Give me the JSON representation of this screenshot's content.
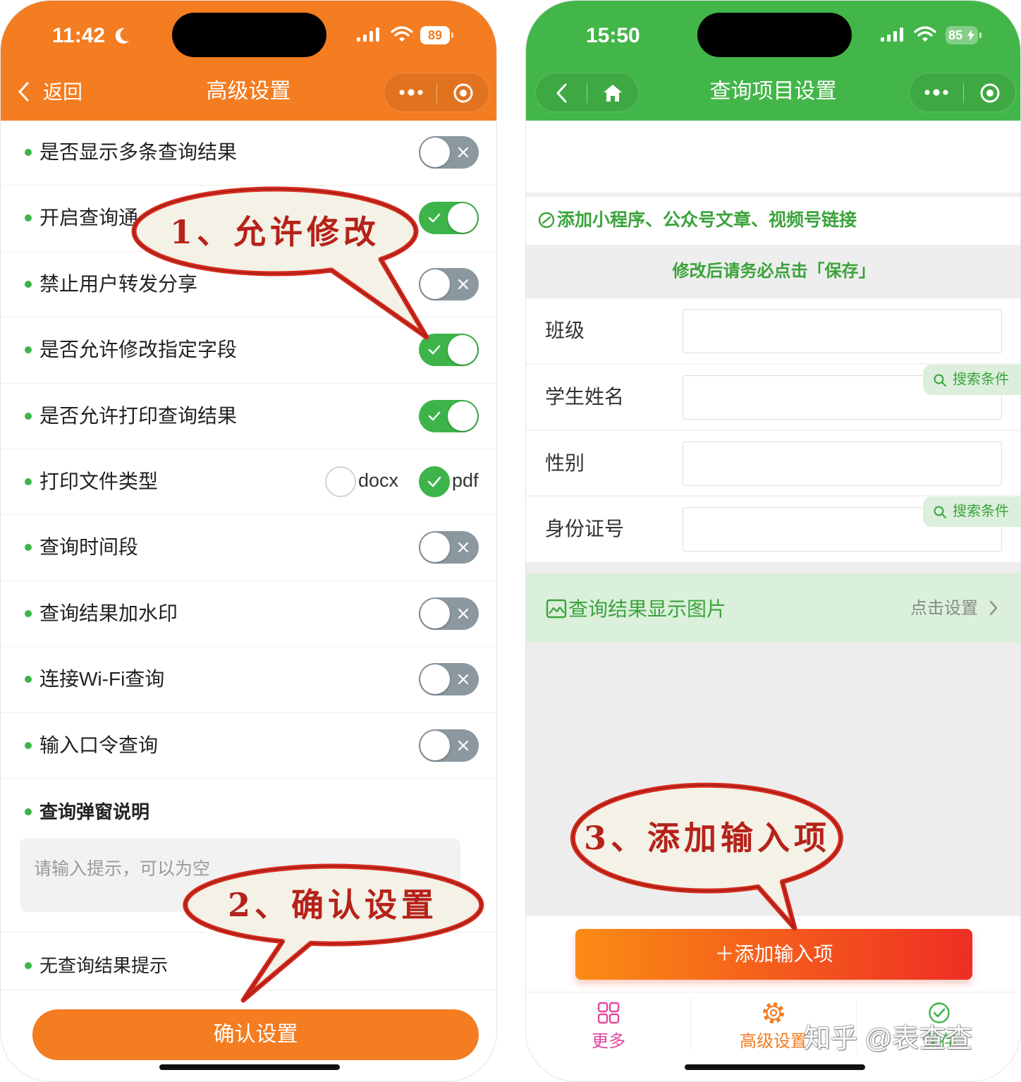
{
  "colors": {
    "left_header": "#F47C21",
    "right_header": "#43B649",
    "accent_green": "#3DB44A",
    "callout_stroke": "#D52B1E",
    "callout_fill": "#F4F1E6"
  },
  "left_phone": {
    "status": {
      "time": "11:42",
      "battery": "89"
    },
    "nav": {
      "back_label": "返回",
      "title": "高级设置"
    },
    "settings": [
      {
        "label": "是否显示多条查询结果",
        "on": false
      },
      {
        "label": "开启查询通",
        "on": true
      },
      {
        "label": "禁止用户转发分享",
        "on": false
      },
      {
        "label": "是否允许修改指定字段",
        "on": true
      },
      {
        "label": "是否允许打印查询结果",
        "on": true
      },
      {
        "label": "查询时间段",
        "on": false
      },
      {
        "label": "查询结果加水印",
        "on": false
      },
      {
        "label": "连接Wi-Fi查询",
        "on": false
      },
      {
        "label": "输入口令查询",
        "on": false
      }
    ],
    "print_type": {
      "label": "打印文件类型",
      "options": [
        "docx",
        "pdf"
      ],
      "selected": "pdf"
    },
    "popup_note": {
      "label": "查询弹窗说明",
      "placeholder": "请输入提示，可以为空"
    },
    "no_result": {
      "label": "无查询结果提示"
    },
    "confirm_button": "确认设置"
  },
  "right_phone": {
    "status": {
      "time": "15:50",
      "battery": "85"
    },
    "nav": {
      "title": "查询项目设置"
    },
    "link_row": "添加小程序、公众号文章、视频号链接",
    "notice": "修改后请务必点击「保存」",
    "fields": [
      {
        "label": "班级"
      },
      {
        "label": "学生姓名",
        "badge": "搜索条件"
      },
      {
        "label": "性别"
      },
      {
        "label": "身份证号",
        "badge": "搜索条件"
      }
    ],
    "result_image": {
      "label": "查询结果显示图片",
      "action": "点击设置"
    },
    "add_button": "＋添加输入项",
    "tabs": [
      {
        "label": "更多",
        "icon": "grid-icon",
        "color": "#E0479E"
      },
      {
        "label": "高级设置",
        "icon": "gear-icon",
        "color": "#F47C21"
      },
      {
        "label": "保存",
        "icon": "check-circle-icon",
        "color": "#3DB44A"
      }
    ]
  },
  "annotations": [
    {
      "text": "1、允许修改"
    },
    {
      "text": "2、确认设置"
    },
    {
      "text": "3、添加输入项"
    }
  ],
  "watermark": "知乎 @表查查"
}
